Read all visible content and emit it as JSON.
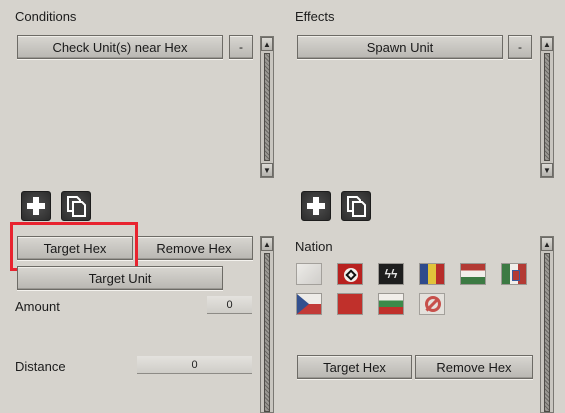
{
  "conditions": {
    "title": "Conditions",
    "items": [
      {
        "label": "Check Unit(s) near Hex",
        "remove_label": "-"
      }
    ]
  },
  "effects": {
    "title": "Effects",
    "items": [
      {
        "label": "Spawn Unit",
        "remove_label": "-"
      }
    ]
  },
  "condition_params": {
    "target_hex_label": "Target Hex",
    "remove_hex_label": "Remove Hex",
    "target_unit_label": "Target Unit",
    "amount_label": "Amount",
    "amount_value": "0",
    "distance_label": "Distance",
    "distance_value": "0"
  },
  "effect_params": {
    "nation_label": "Nation",
    "flags": [
      "white-flag-icon",
      "swastika-flag-icon",
      "ss-flag-icon",
      "romania-flag-icon",
      "hungary-flag-icon",
      "italy-flag-icon",
      "czechoslovakia-flag-icon",
      "red-flag-icon",
      "bulgaria-flag-icon",
      "no-nation-icon"
    ],
    "target_hex_label": "Target Hex",
    "remove_hex_label": "Remove Hex"
  },
  "colors": {
    "highlight": "#e8232f",
    "background": "#d6d3cd"
  }
}
